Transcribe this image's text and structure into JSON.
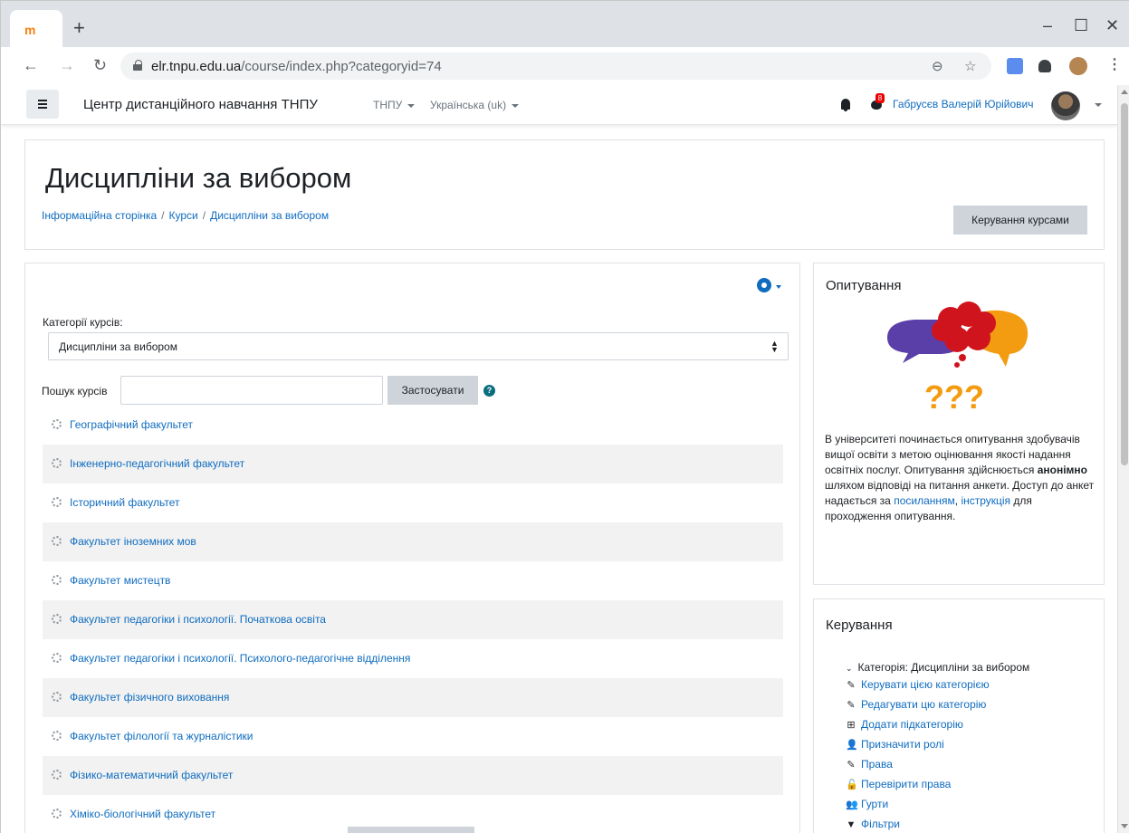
{
  "browser": {
    "tab_favicon": "m",
    "new_tab": "+",
    "window_controls": {
      "minimize": "–",
      "maximize": "☐",
      "close": "✕"
    },
    "nav": {
      "back": "←",
      "forward": "→",
      "reload": "↻"
    },
    "url_host": "elr.tnpu.edu.ua",
    "url_path": "/course/index.php?categoryid=74",
    "icons": [
      "zoom-icon",
      "star-icon",
      "translate-icon",
      "extensions-icon",
      "profile-icon",
      "menu-icon"
    ],
    "kebab": "⋮"
  },
  "navbar": {
    "site_name": "Центр дистанційного навчання ТНПУ",
    "menu_tnpu": "ТНПУ",
    "menu_lang": "Українська (uk)",
    "message_badge": "8",
    "user_name": "Габрусєв Валерій Юрійович"
  },
  "header": {
    "title": "Дисципліни за вибором",
    "breadcrumb": [
      "Інформаційна сторінка",
      "Курси",
      "Дисципліни за вибором"
    ],
    "manage_button": "Керування курсами"
  },
  "main": {
    "category_label": "Категорії курсів:",
    "category_value": "Дисципліни за вибором",
    "search_label": "Пошук курсів",
    "search_value": "",
    "apply_button": "Застосувати",
    "help": "?",
    "categories": [
      "Географічний факультет",
      "Інженерно-педагогічний факультет",
      "Історичний факультет",
      "Факультет іноземних мов",
      "Факультет мистецтв",
      "Факультет педагогіки і психології. Початкова освіта",
      "Факультет педагогіки і психології. Психолого-педагогічне відділення",
      "Факультет фізичного виховання",
      "Факультет філології та журналістики",
      "Фізико-математичний факультет",
      "Хіміко-біологічний факультет"
    ]
  },
  "survey": {
    "title": "Опитування",
    "art_text": "???",
    "text_1": "В університеті починається  опитування здобувачів вищої освіти  з метою оцінювання якості надання освітніх послуг. Опитування здійснюється ",
    "text_bold": "анонімно",
    "text_2": " шляхом відповіді на питання анкети. Доступ до анкет надається за ",
    "link_1": "посиланням",
    "text_3": ", ",
    "link_2": "інструкція",
    "text_4": " для проходження опитування."
  },
  "admin": {
    "title": "Керування",
    "root": "Категорія: Дисципліни за вибором",
    "items": [
      {
        "icon": "pencil-icon",
        "glyph": "✎",
        "label": "Керувати цією категорією"
      },
      {
        "icon": "pencil-icon",
        "glyph": "✎",
        "label": "Редагувати цю категорію"
      },
      {
        "icon": "plus-square-icon",
        "glyph": "⊞",
        "label": "Додати підкатегорію"
      },
      {
        "icon": "user-plus-icon",
        "glyph": "👤",
        "label": "Призначити ролі"
      },
      {
        "icon": "edit-square-icon",
        "glyph": "✎",
        "label": "Права"
      },
      {
        "icon": "unlock-icon",
        "glyph": "🔓",
        "label": "Перевірити права"
      },
      {
        "icon": "users-icon",
        "glyph": "👥",
        "label": "Гурти"
      },
      {
        "icon": "filter-icon",
        "glyph": "▼",
        "label": "Фільтри"
      }
    ]
  }
}
